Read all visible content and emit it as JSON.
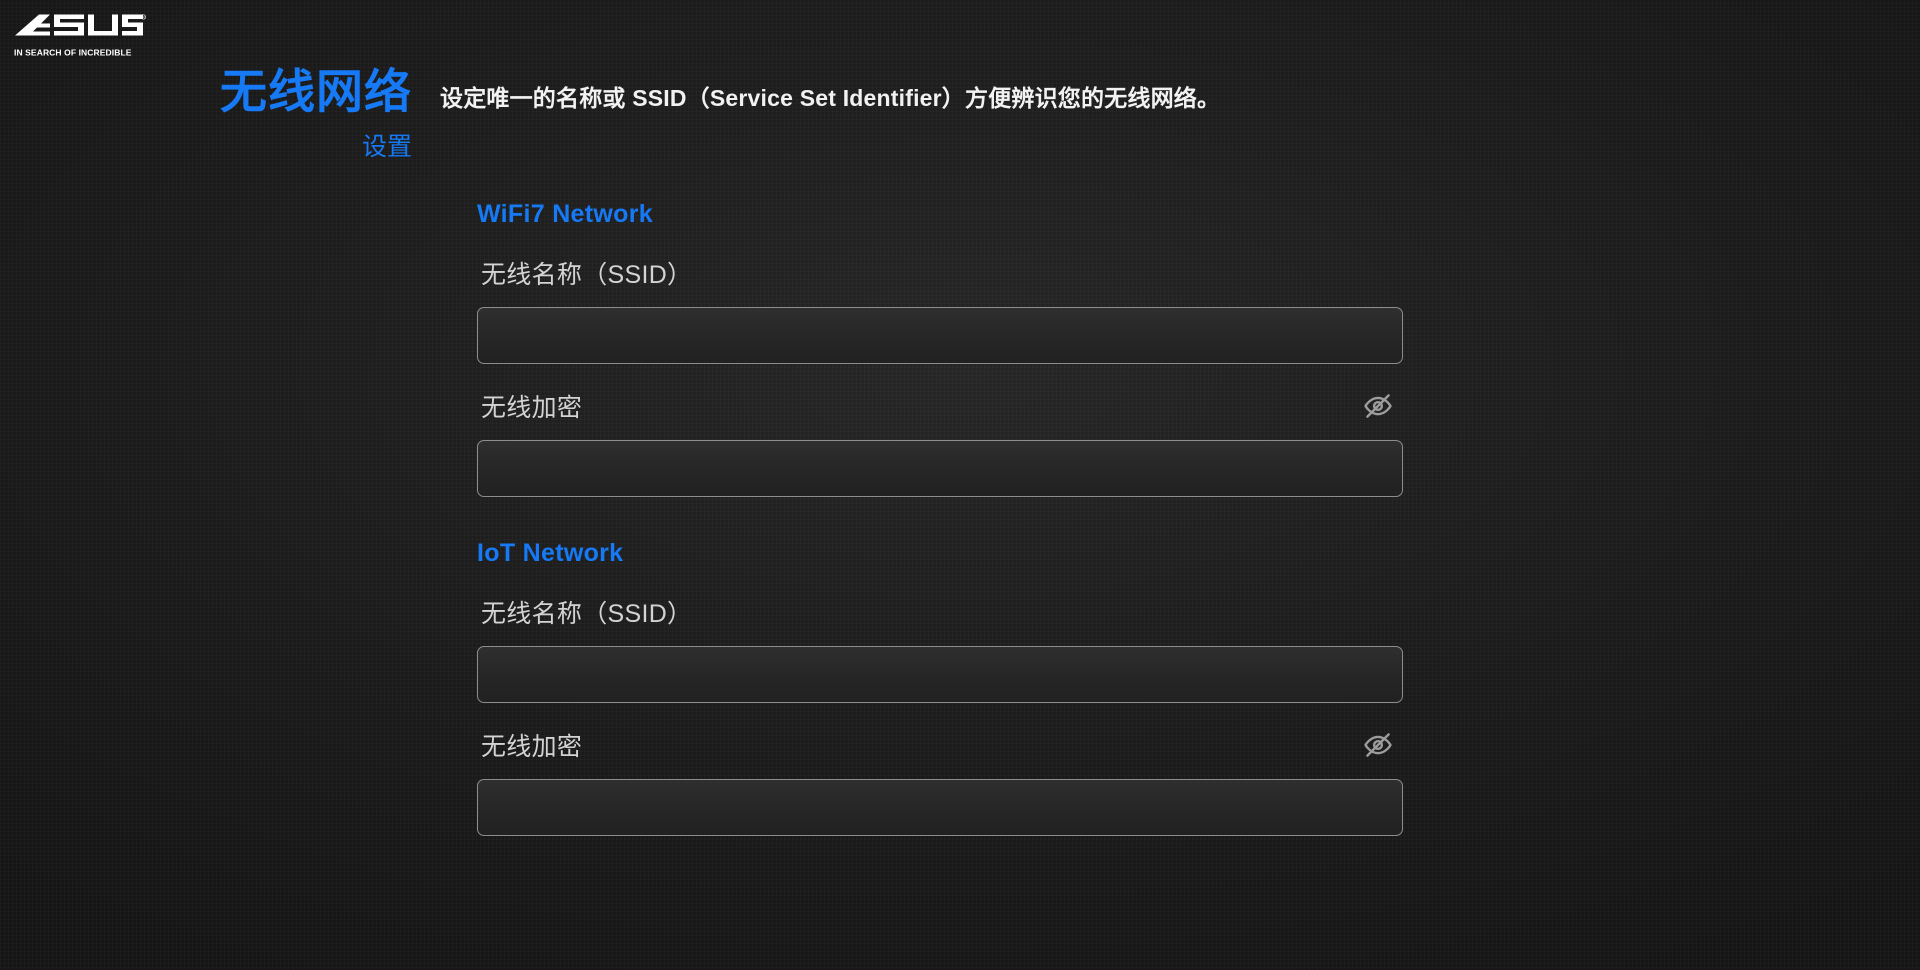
{
  "brand": {
    "name": "ASUS",
    "tagline": "IN SEARCH OF INCREDIBLE",
    "logo_icon": "asus-logo-icon"
  },
  "header": {
    "title": "无线网络",
    "subtitle": "设置",
    "description": "设定唯一的名称或 SSID（Service Set Identifier）方便辨识您的无线网络。"
  },
  "colors": {
    "accent_blue": "#1679f5",
    "background": "#1a1a1a",
    "input_border": "#8d8d8d",
    "label_text": "#d3d3d3"
  },
  "sections": [
    {
      "heading": "WiFi7 Network",
      "ssid": {
        "label": "无线名称（SSID）",
        "value": "",
        "placeholder": ""
      },
      "password": {
        "label": "无线加密",
        "value": "",
        "placeholder": "",
        "toggle_icon": "eye-off-icon"
      }
    },
    {
      "heading": "IoT Network",
      "ssid": {
        "label": "无线名称（SSID）",
        "value": "",
        "placeholder": ""
      },
      "password": {
        "label": "无线加密",
        "value": "",
        "placeholder": "",
        "toggle_icon": "eye-off-icon"
      }
    }
  ]
}
